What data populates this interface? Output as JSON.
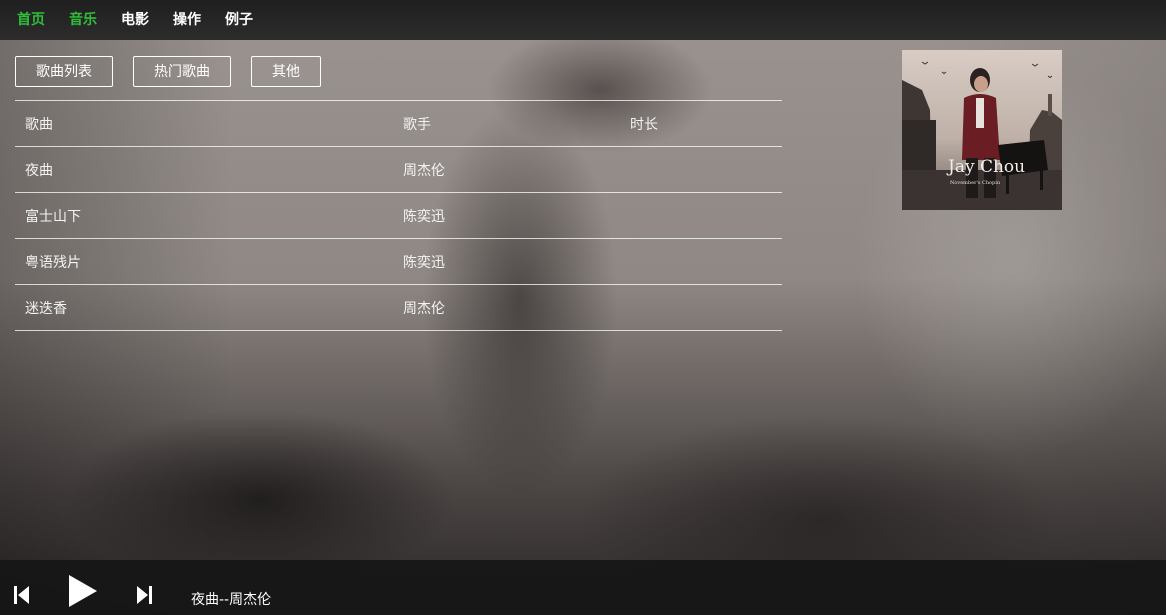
{
  "nav": {
    "items": [
      {
        "label": "首页",
        "active": true
      },
      {
        "label": "音乐",
        "active": true
      },
      {
        "label": "电影",
        "active": false
      },
      {
        "label": "操作",
        "active": false
      },
      {
        "label": "例子",
        "active": false
      }
    ],
    "active_color": "#2fbf3a"
  },
  "tabs": [
    {
      "label": "歌曲列表"
    },
    {
      "label": "热门歌曲"
    },
    {
      "label": "其他"
    }
  ],
  "table": {
    "headers": [
      "歌曲",
      "歌手",
      "时长"
    ],
    "rows": [
      {
        "song": "夜曲",
        "artist": "周杰伦",
        "duration": ""
      },
      {
        "song": "富士山下",
        "artist": "陈奕迅",
        "duration": ""
      },
      {
        "song": "粤语残片",
        "artist": "陈奕迅",
        "duration": ""
      },
      {
        "song": "迷迭香",
        "artist": "周杰伦",
        "duration": ""
      }
    ]
  },
  "album": {
    "title_text": "Jay Chou",
    "subtitle_text": "November's Chopin"
  },
  "player": {
    "now_playing": "夜曲--周杰伦",
    "icons": [
      "skip-previous-icon",
      "play-icon",
      "skip-next-icon"
    ]
  }
}
